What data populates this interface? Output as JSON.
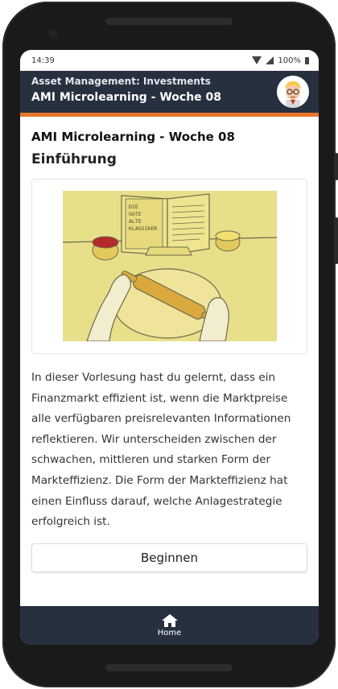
{
  "status_bar": {
    "time": "14:39",
    "battery": "100%"
  },
  "header": {
    "subtitle": "Asset Management: Investments",
    "title": "AMI Microlearning - Woche 08"
  },
  "main": {
    "page_title": "AMI Microlearning - Woche 08",
    "section_title": "Einführung",
    "illustration_book_text": [
      "DIE",
      "GUTE",
      "ALTE",
      "KLASSIKER"
    ],
    "body_text": "In dieser Vorlesung hast du gelernt, dass ein Finanzmarkt effizient ist, wenn die Marktpreise alle verfügbaren preisrelevanten Informationen reflektieren. Wir unterscheiden zwischen der schwachen, mittleren und starken Form der Markteffizienz. Die Form der Markteffizienz hat einen Einfluss darauf, welche Anlagestrategie erfolgreich ist.",
    "begin_button": "Beginnen"
  },
  "bottom_nav": {
    "home_label": "Home",
    "icon": "home-icon"
  },
  "colors": {
    "header_bg": "#27303f",
    "accent": "#e9762b",
    "illustration_bg": "#e8df8a"
  }
}
